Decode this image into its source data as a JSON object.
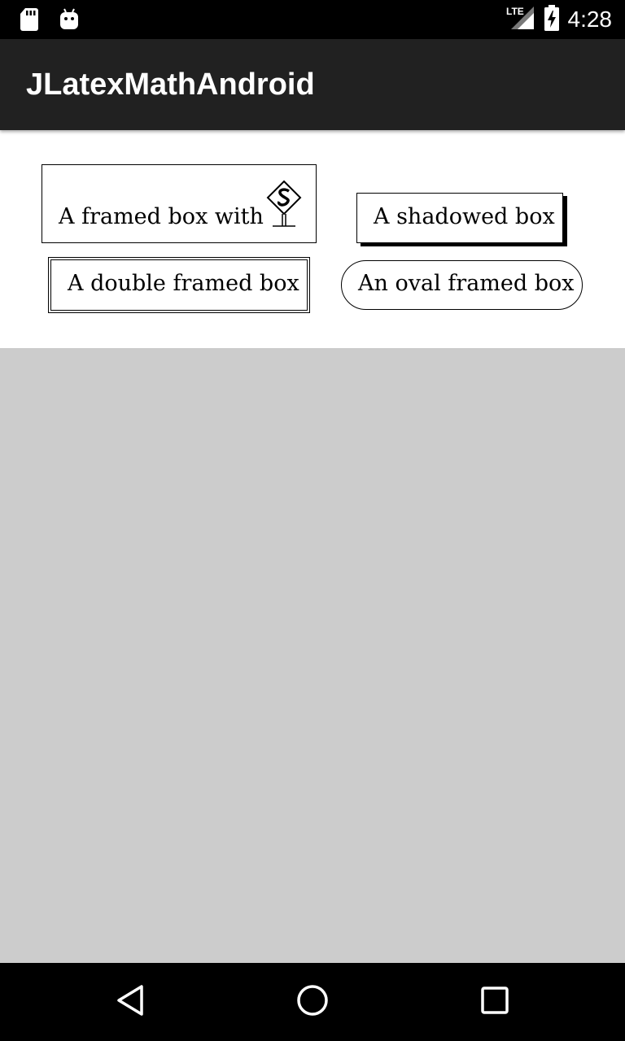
{
  "status_bar": {
    "time": "4:28",
    "network": "LTE",
    "icons": [
      "sd-card-icon",
      "android-icon",
      "lte-signal-icon",
      "battery-charging-icon"
    ]
  },
  "app_bar": {
    "title": "JLatexMathAndroid"
  },
  "latex_boxes": {
    "framed": "A framed box with",
    "shadowed": "A shadowed box",
    "double": "A double framed box",
    "oval": "An oval framed box"
  },
  "nav_bar": {
    "icons": [
      "back-icon",
      "home-icon",
      "recents-icon"
    ]
  },
  "colors": {
    "status_bar": "#000000",
    "app_bar": "#212121",
    "content_bg": "#ffffff",
    "window_bg": "#cccccc"
  }
}
